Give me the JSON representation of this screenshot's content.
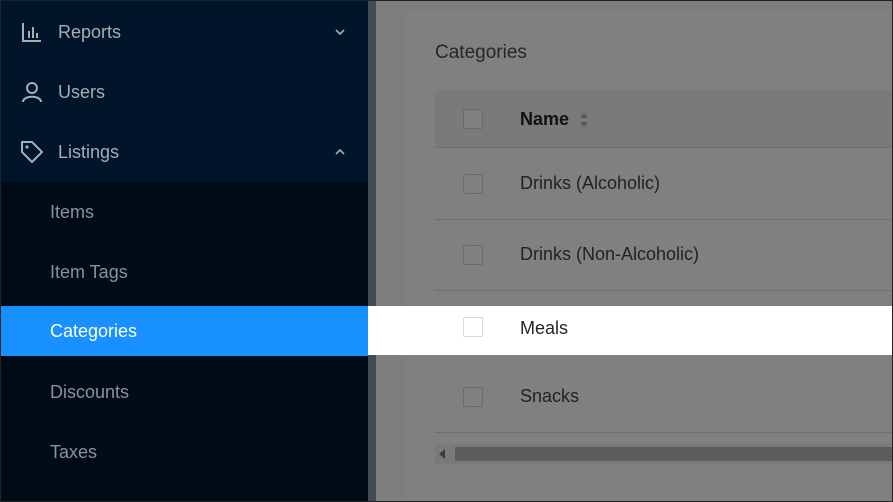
{
  "sidebar": {
    "items": [
      {
        "label": "Reports",
        "icon": "bar-chart-icon",
        "expanded": false
      },
      {
        "label": "Users",
        "icon": "user-icon"
      },
      {
        "label": "Listings",
        "icon": "tag-icon",
        "expanded": true
      }
    ],
    "submenu": [
      {
        "label": "Items"
      },
      {
        "label": "Item Tags"
      },
      {
        "label": "Categories",
        "selected": true
      },
      {
        "label": "Discounts"
      },
      {
        "label": "Taxes"
      }
    ]
  },
  "main": {
    "title": "Categories",
    "table": {
      "header": {
        "name": "Name"
      },
      "rows": [
        {
          "name": "Drinks (Alcoholic)"
        },
        {
          "name": "Drinks (Non-Alcoholic)"
        },
        {
          "name": "Meals",
          "highlighted": true
        },
        {
          "name": "Snacks"
        }
      ]
    }
  },
  "colors": {
    "sidebar_bg": "#001529",
    "submenu_bg": "#000c17",
    "selected": "#1890ff",
    "overlay_bg": "#7e7e7e"
  }
}
